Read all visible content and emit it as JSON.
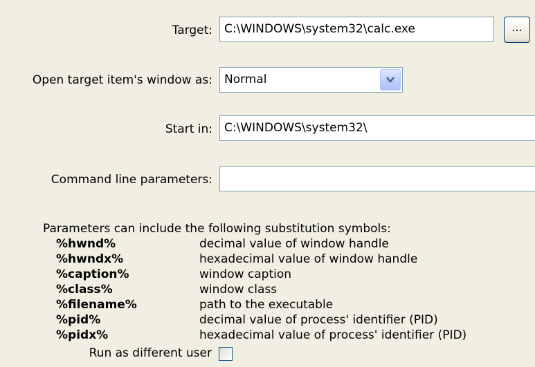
{
  "target": {
    "label": "Target:",
    "value": "C:\\WINDOWS\\system32\\calc.exe",
    "browse_label": "..."
  },
  "open_as": {
    "label": "Open target item's window as:",
    "selected": "Normal"
  },
  "start_in": {
    "label": "Start in:",
    "value": "C:\\WINDOWS\\system32\\"
  },
  "cmdline": {
    "label": "Command line parameters:",
    "value": ""
  },
  "params_intro": "Parameters can include the following substitution symbols:",
  "symbols": [
    {
      "name": "%hwnd%",
      "desc": "decimal value of window handle"
    },
    {
      "name": "%hwndx%",
      "desc": "hexadecimal value of window handle"
    },
    {
      "name": "%caption%",
      "desc": "window caption"
    },
    {
      "name": "%class%",
      "desc": "window class"
    },
    {
      "name": "%filename%",
      "desc": "path to the executable"
    },
    {
      "name": "%pid%",
      "desc": "decimal value of process' identifier (PID)"
    },
    {
      "name": "%pidx%",
      "desc": "hexadecimal value of process' identifier (PID)"
    }
  ],
  "run_as": {
    "label": "Run as different user",
    "checked": false
  }
}
